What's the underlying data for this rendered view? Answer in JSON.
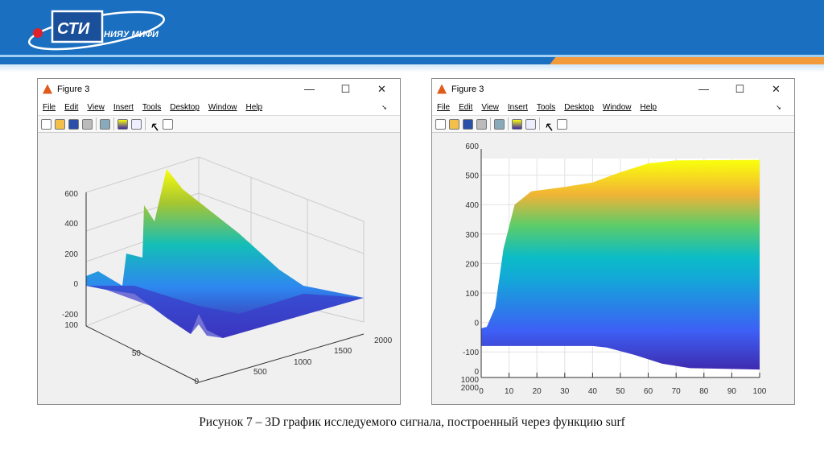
{
  "header": {
    "logo_main": "СТИ",
    "logo_sub": "НИЯУ МИФИ"
  },
  "windows": [
    {
      "title": "Figure 3",
      "controls": [
        "—",
        "☐",
        "✕"
      ],
      "menu": [
        "File",
        "Edit",
        "View",
        "Insert",
        "Tools",
        "Desktop",
        "Window",
        "Help"
      ]
    },
    {
      "title": "Figure 3",
      "controls": [
        "—",
        "☐",
        "✕"
      ],
      "menu": [
        "File",
        "Edit",
        "View",
        "Insert",
        "Tools",
        "Desktop",
        "Window",
        "Help"
      ]
    }
  ],
  "toolbar_icons": [
    "new-file-icon",
    "open-folder-icon",
    "save-icon",
    "print-icon",
    "print-preview-icon",
    "colorbar-icon",
    "legend-icon",
    "pointer-icon",
    "property-inspector-icon"
  ],
  "caption": "Рисунок 7 – 3D график исследуемого сигнала, построенный через функцию surf",
  "chart_data": [
    {
      "type": "surface",
      "view": "3d",
      "z_ticks": [
        "600",
        "400",
        "200",
        "0",
        "-200"
      ],
      "y_ticks": [
        "100",
        "50",
        "0"
      ],
      "x_ticks": [
        "500",
        "1000",
        "1500",
        "2000"
      ]
    },
    {
      "type": "area",
      "view": "side",
      "colormap": "parula",
      "x_ticks": [
        "0",
        "10",
        "20",
        "30",
        "40",
        "50",
        "60",
        "70",
        "80",
        "90",
        "100"
      ],
      "z_ticks": [
        "600",
        "500",
        "400",
        "300",
        "200",
        "100",
        "0",
        "-100"
      ],
      "depth_ticks": [
        "0",
        "1000",
        "2000"
      ],
      "xlim": [
        0,
        100
      ],
      "zlim": [
        -180,
        600
      ],
      "upper": {
        "x": [
          0,
          2,
          5,
          8,
          12,
          18,
          30,
          40,
          50,
          60,
          70,
          100
        ],
        "z": [
          -20,
          -15,
          50,
          250,
          400,
          445,
          460,
          475,
          510,
          540,
          550,
          552
        ]
      },
      "lower": {
        "x": [
          0,
          40,
          45,
          55,
          65,
          75,
          100
        ],
        "z": [
          -80,
          -80,
          -85,
          -110,
          -140,
          -155,
          -160
        ]
      }
    }
  ]
}
